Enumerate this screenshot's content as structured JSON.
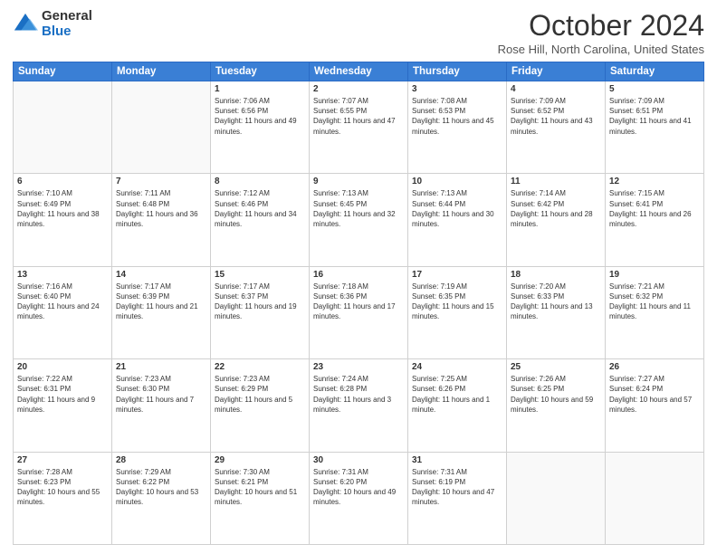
{
  "header": {
    "logo_general": "General",
    "logo_blue": "Blue",
    "month_title": "October 2024",
    "location": "Rose Hill, North Carolina, United States"
  },
  "days_of_week": [
    "Sunday",
    "Monday",
    "Tuesday",
    "Wednesday",
    "Thursday",
    "Friday",
    "Saturday"
  ],
  "weeks": [
    [
      {
        "day": "",
        "text": ""
      },
      {
        "day": "",
        "text": ""
      },
      {
        "day": "1",
        "text": "Sunrise: 7:06 AM\nSunset: 6:56 PM\nDaylight: 11 hours and 49 minutes."
      },
      {
        "day": "2",
        "text": "Sunrise: 7:07 AM\nSunset: 6:55 PM\nDaylight: 11 hours and 47 minutes."
      },
      {
        "day": "3",
        "text": "Sunrise: 7:08 AM\nSunset: 6:53 PM\nDaylight: 11 hours and 45 minutes."
      },
      {
        "day": "4",
        "text": "Sunrise: 7:09 AM\nSunset: 6:52 PM\nDaylight: 11 hours and 43 minutes."
      },
      {
        "day": "5",
        "text": "Sunrise: 7:09 AM\nSunset: 6:51 PM\nDaylight: 11 hours and 41 minutes."
      }
    ],
    [
      {
        "day": "6",
        "text": "Sunrise: 7:10 AM\nSunset: 6:49 PM\nDaylight: 11 hours and 38 minutes."
      },
      {
        "day": "7",
        "text": "Sunrise: 7:11 AM\nSunset: 6:48 PM\nDaylight: 11 hours and 36 minutes."
      },
      {
        "day": "8",
        "text": "Sunrise: 7:12 AM\nSunset: 6:46 PM\nDaylight: 11 hours and 34 minutes."
      },
      {
        "day": "9",
        "text": "Sunrise: 7:13 AM\nSunset: 6:45 PM\nDaylight: 11 hours and 32 minutes."
      },
      {
        "day": "10",
        "text": "Sunrise: 7:13 AM\nSunset: 6:44 PM\nDaylight: 11 hours and 30 minutes."
      },
      {
        "day": "11",
        "text": "Sunrise: 7:14 AM\nSunset: 6:42 PM\nDaylight: 11 hours and 28 minutes."
      },
      {
        "day": "12",
        "text": "Sunrise: 7:15 AM\nSunset: 6:41 PM\nDaylight: 11 hours and 26 minutes."
      }
    ],
    [
      {
        "day": "13",
        "text": "Sunrise: 7:16 AM\nSunset: 6:40 PM\nDaylight: 11 hours and 24 minutes."
      },
      {
        "day": "14",
        "text": "Sunrise: 7:17 AM\nSunset: 6:39 PM\nDaylight: 11 hours and 21 minutes."
      },
      {
        "day": "15",
        "text": "Sunrise: 7:17 AM\nSunset: 6:37 PM\nDaylight: 11 hours and 19 minutes."
      },
      {
        "day": "16",
        "text": "Sunrise: 7:18 AM\nSunset: 6:36 PM\nDaylight: 11 hours and 17 minutes."
      },
      {
        "day": "17",
        "text": "Sunrise: 7:19 AM\nSunset: 6:35 PM\nDaylight: 11 hours and 15 minutes."
      },
      {
        "day": "18",
        "text": "Sunrise: 7:20 AM\nSunset: 6:33 PM\nDaylight: 11 hours and 13 minutes."
      },
      {
        "day": "19",
        "text": "Sunrise: 7:21 AM\nSunset: 6:32 PM\nDaylight: 11 hours and 11 minutes."
      }
    ],
    [
      {
        "day": "20",
        "text": "Sunrise: 7:22 AM\nSunset: 6:31 PM\nDaylight: 11 hours and 9 minutes."
      },
      {
        "day": "21",
        "text": "Sunrise: 7:23 AM\nSunset: 6:30 PM\nDaylight: 11 hours and 7 minutes."
      },
      {
        "day": "22",
        "text": "Sunrise: 7:23 AM\nSunset: 6:29 PM\nDaylight: 11 hours and 5 minutes."
      },
      {
        "day": "23",
        "text": "Sunrise: 7:24 AM\nSunset: 6:28 PM\nDaylight: 11 hours and 3 minutes."
      },
      {
        "day": "24",
        "text": "Sunrise: 7:25 AM\nSunset: 6:26 PM\nDaylight: 11 hours and 1 minute."
      },
      {
        "day": "25",
        "text": "Sunrise: 7:26 AM\nSunset: 6:25 PM\nDaylight: 10 hours and 59 minutes."
      },
      {
        "day": "26",
        "text": "Sunrise: 7:27 AM\nSunset: 6:24 PM\nDaylight: 10 hours and 57 minutes."
      }
    ],
    [
      {
        "day": "27",
        "text": "Sunrise: 7:28 AM\nSunset: 6:23 PM\nDaylight: 10 hours and 55 minutes."
      },
      {
        "day": "28",
        "text": "Sunrise: 7:29 AM\nSunset: 6:22 PM\nDaylight: 10 hours and 53 minutes."
      },
      {
        "day": "29",
        "text": "Sunrise: 7:30 AM\nSunset: 6:21 PM\nDaylight: 10 hours and 51 minutes."
      },
      {
        "day": "30",
        "text": "Sunrise: 7:31 AM\nSunset: 6:20 PM\nDaylight: 10 hours and 49 minutes."
      },
      {
        "day": "31",
        "text": "Sunrise: 7:31 AM\nSunset: 6:19 PM\nDaylight: 10 hours and 47 minutes."
      },
      {
        "day": "",
        "text": ""
      },
      {
        "day": "",
        "text": ""
      }
    ]
  ]
}
